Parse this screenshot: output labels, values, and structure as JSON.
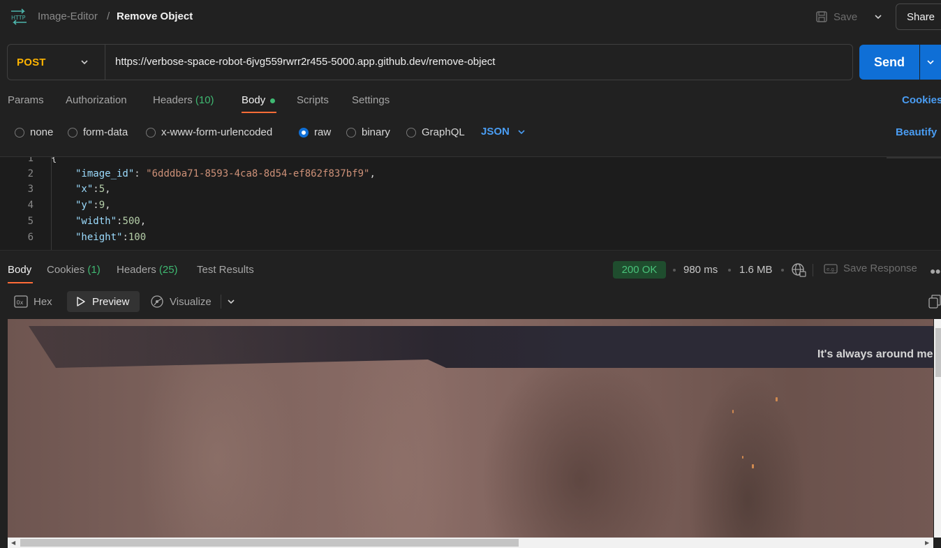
{
  "header": {
    "collection": "Image-Editor",
    "separator": "/",
    "request_name": "Remove Object",
    "save_label": "Save",
    "share_label": "Share"
  },
  "request": {
    "method": "POST",
    "url": "https://verbose-space-robot-6jvg559rwrr2r455-5000.app.github.dev/remove-object",
    "send_label": "Send"
  },
  "request_tabs": {
    "params": "Params",
    "authorization": "Authorization",
    "headers": "Headers",
    "headers_count": "(10)",
    "body": "Body",
    "scripts": "Scripts",
    "settings": "Settings",
    "cookies": "Cookies"
  },
  "body_types": {
    "none": "none",
    "form_data": "form-data",
    "urlencoded": "x-www-form-urlencoded",
    "raw": "raw",
    "binary": "binary",
    "graphql": "GraphQL",
    "selected": "raw",
    "format": "JSON",
    "beautify": "Beautify"
  },
  "editor": {
    "lines": [
      {
        "n": "1",
        "text": "{"
      },
      {
        "n": "2",
        "key": "\"image_id\"",
        "sep": ": ",
        "value": "\"6dddba71-8593-4ca8-8d54-ef862f837bf9\"",
        "tail": ","
      },
      {
        "n": "3",
        "key": "\"x\"",
        "sep": ":",
        "value": "5",
        "tail": ","
      },
      {
        "n": "4",
        "key": "\"y\"",
        "sep": ":",
        "value": "9",
        "tail": ","
      },
      {
        "n": "5",
        "key": "\"width\"",
        "sep": ":",
        "value": "500",
        "tail": ","
      },
      {
        "n": "6",
        "key": "\"height\"",
        "sep": ":",
        "value": "100",
        "tail": ""
      }
    ]
  },
  "response_tabs": {
    "body": "Body",
    "cookies": "Cookies",
    "cookies_count": "(1)",
    "headers": "Headers",
    "headers_count": "(25)",
    "test_results": "Test Results"
  },
  "response_meta": {
    "status": "200 OK",
    "time": "980 ms",
    "size": "1.6 MB",
    "save_response": "Save Response"
  },
  "view_modes": {
    "hex": "Hex",
    "preview": "Preview",
    "visualize": "Visualize"
  },
  "preview": {
    "caption": "It's always around me,"
  },
  "colors": {
    "accent_orange": "#ff6c37",
    "send_blue": "#0f6fd6",
    "method_yellow": "#ffb400",
    "success_green": "#49c27a",
    "link_blue": "#4a9df3"
  }
}
